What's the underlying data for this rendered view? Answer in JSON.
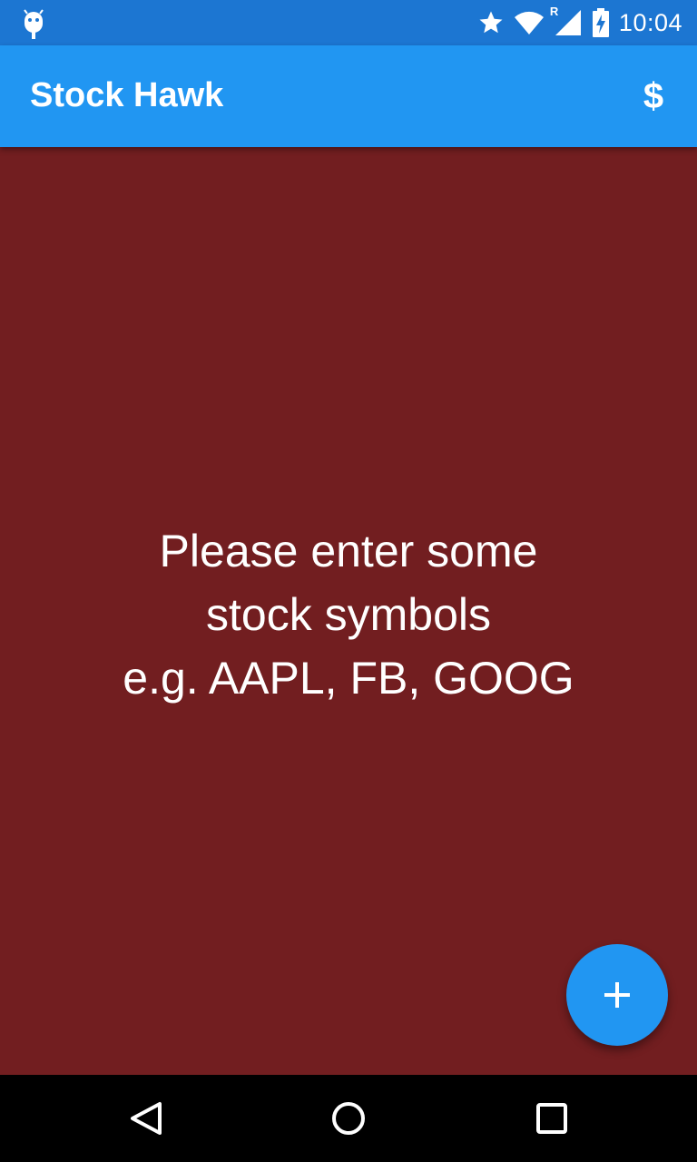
{
  "status_bar": {
    "time": "10:04",
    "roaming_indicator": "R",
    "icons": [
      "android-debug-icon",
      "star-icon",
      "wifi-icon",
      "signal-icon",
      "battery-charging-icon"
    ]
  },
  "app_bar": {
    "title": "Stock Hawk",
    "action_label": "$",
    "action_icon": "dollar-icon"
  },
  "main": {
    "empty_message": {
      "line1": "Please enter some",
      "line2": "stock symbols",
      "line3": "e.g. AAPL, FB, GOOG"
    },
    "fab_icon": "plus-icon"
  },
  "nav_bar": {
    "icons": [
      "back-icon",
      "home-icon",
      "recents-icon"
    ]
  },
  "colors": {
    "status_bar": "#1c76d2",
    "app_bar": "#2196f2",
    "background": "#721e20",
    "fab": "#2196f2",
    "nav_bar": "#000000",
    "text": "#ffffff"
  }
}
